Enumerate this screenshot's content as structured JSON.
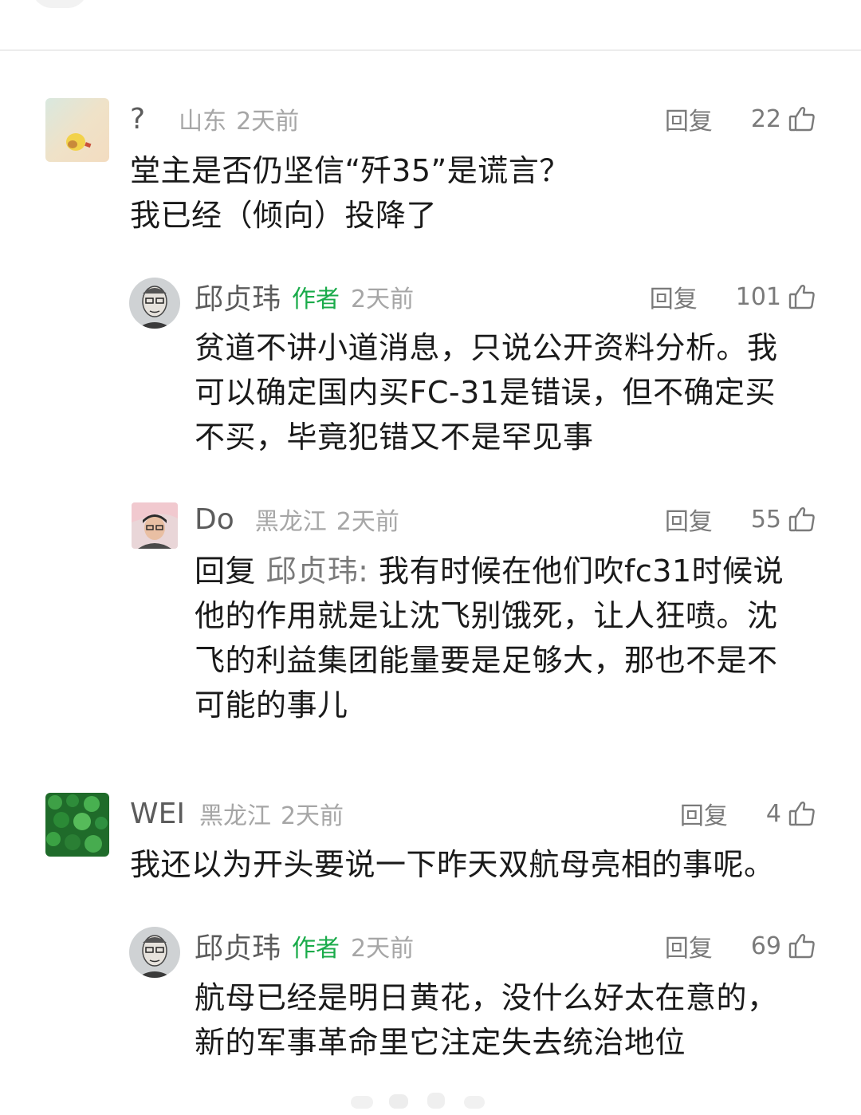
{
  "comments": [
    {
      "username": "?",
      "location": "山东",
      "time": "2天前",
      "reply_label": "回复",
      "likes": "22",
      "text_lines": [
        "堂主是否仍坚信“歼35”是谎言？",
        "我已经（倾向）投降了"
      ]
    },
    {
      "username": "邱贞玮",
      "author_tag": "作者",
      "time": "2天前",
      "reply_label": "回复",
      "likes": "101",
      "text_lines": [
        "贫道不讲小道消息，只说公开资料分析。我",
        "可以确定国内买FC-31是错误，但不确定买",
        "不买，毕竟犯错又不是罕见事"
      ]
    },
    {
      "username": "Do",
      "location": "黑龙江",
      "time": "2天前",
      "reply_label": "回复",
      "likes": "55",
      "reply_prefix": "回复",
      "reply_target": "邱贞玮:",
      "text_first": "我有时候在他们吹fc31时候说",
      "text_lines": [
        "他的作用就是让沈飞别饿死，让人狂喷。沈",
        "飞的利益集团能量要是足够大，那也不是不",
        "可能的事儿"
      ]
    },
    {
      "username": "WEI",
      "location": "黑龙江",
      "time": "2天前",
      "reply_label": "回复",
      "likes": "4",
      "text_lines": [
        "我还以为开头要说一下昨天双航母亮相的事呢。"
      ]
    },
    {
      "username": "邱贞玮",
      "author_tag": "作者",
      "time": "2天前",
      "reply_label": "回复",
      "likes": "69",
      "text_lines": [
        "航母已经是明日黄花，没什么好太在意的，",
        "新的军事革命里它注定失去统治地位"
      ]
    }
  ],
  "icons": {
    "like": "thumbs-up-icon"
  },
  "colors": {
    "author_tag": "#1aab4a",
    "meta": "#a6a6a6",
    "username": "#5c5c5c"
  }
}
